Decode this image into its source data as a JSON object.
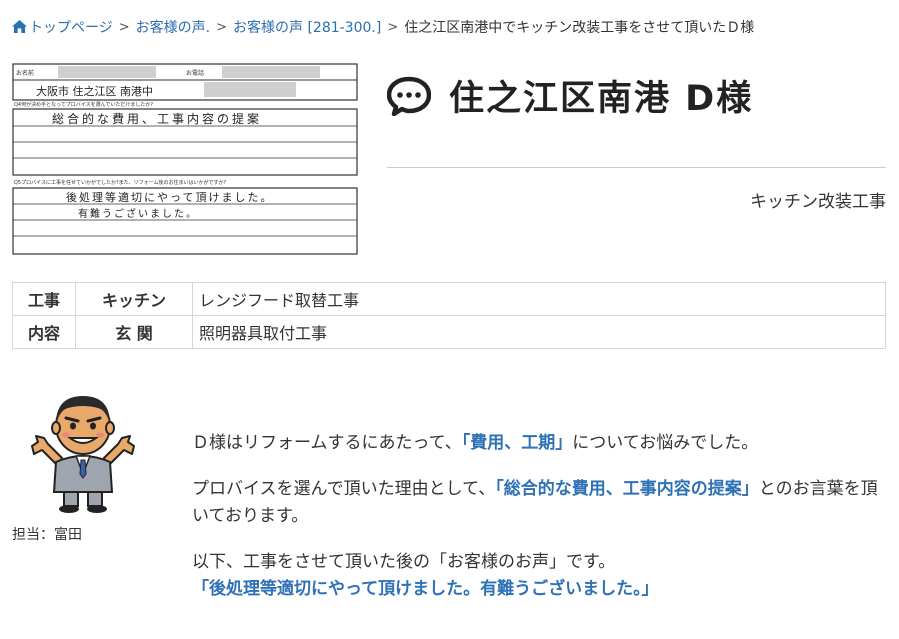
{
  "breadcrumb": {
    "home": "トップページ",
    "voices_short": "お客様の声.",
    "voices_range": "お客様の声 [281-300.]",
    "current": "住之江区南港中でキッチン改装工事をさせて頂いたＤ様"
  },
  "survey": {
    "name_label": "お名前",
    "phone_label": "お電話",
    "address_handwritten": "大阪市 住之江区 南港中",
    "q4": "Q4何が決め手となってプロバイスを選んでいただけましたか?",
    "q4_answer": "総合的な費用、工事内容の提案",
    "q5": "Q5プロバイスに工事を任せていかがでしたか?また、リフォーム後のお住まいはいかがですか?",
    "q5_answer_1": "後処理等適切にやって頂けました。",
    "q5_answer_2": "有難うございました。"
  },
  "title": "住之江区南港 D様",
  "category": "キッチン改装工事",
  "works": {
    "head_1": "工事",
    "head_2": "内容",
    "rows": [
      {
        "place": "キッチン",
        "desc": "レンジフード取替工事"
      },
      {
        "place": "玄 関",
        "desc": "照明器具取付工事"
      }
    ]
  },
  "staff": {
    "label": "担当：富田"
  },
  "comments": {
    "p1_pre": "Ｄ様はリフォームするにあたって、",
    "p1_hl": "「費用、工期」",
    "p1_post": "についてお悩みでした。",
    "p2_pre": "プロバイスを選んで頂いた理由として、",
    "p2_hl": "「総合的な費用、工事内容の提案」",
    "p2_post": "とのお言葉を頂いております。",
    "p3": "以下、工事をさせて頂いた後の「お客様のお声」です。",
    "voice": "「後処理等適切にやって頂けました。有難うございました。」"
  },
  "colors": {
    "link": "#2a6fb0",
    "highlight": "#2f71b7",
    "text": "#333333"
  },
  "icons": {
    "home": "home-icon",
    "title": "speech-bubble-icon",
    "staff": "staff-mascot-icon"
  }
}
